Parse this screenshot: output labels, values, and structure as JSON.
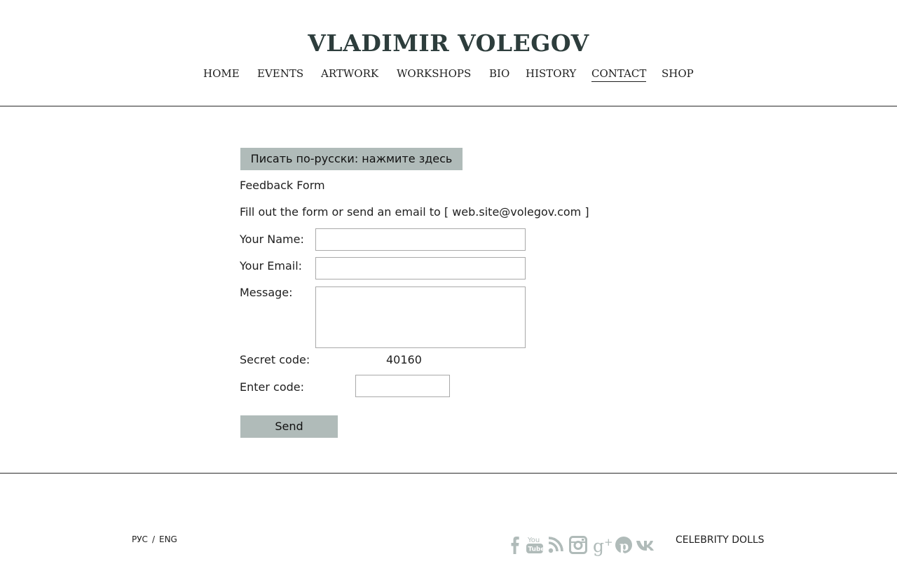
{
  "header": {
    "title": "VLADIMIR VOLEGOV",
    "nav": [
      {
        "label": "HOME"
      },
      {
        "label": "EVENTS"
      },
      {
        "label": "ARTWORK"
      },
      {
        "label": "WORKSHOPS"
      },
      {
        "label": "BIO"
      },
      {
        "label": "HISTORY"
      },
      {
        "label": "CONTACT",
        "active": true
      },
      {
        "label": "SHOP"
      }
    ]
  },
  "form": {
    "russian_button": "Писать по-русски: нажмите здесь",
    "heading": "Feedback Form",
    "intro": "Fill out the form or send an email to [ web.site@volegov.com ]",
    "name_label": "Your Name:",
    "name_value": "",
    "email_label": "Your Email:",
    "email_value": "",
    "message_label": "Message:",
    "message_value": "",
    "secret_label": "Secret code:",
    "secret_value": "40160",
    "enter_code_label": "Enter code:",
    "enter_code_value": "",
    "send_label": "Send"
  },
  "footer": {
    "lang_ru": "РУС",
    "lang_sep": "/",
    "lang_en": "ENG",
    "social_icons": [
      "facebook-icon",
      "youtube-icon",
      "rss-icon",
      "instagram-icon",
      "google-plus-icon",
      "pinterest-icon",
      "vk-icon"
    ],
    "social_color": "#b0bbb9",
    "celebrity_link": "CELEBRITY DOLLS"
  },
  "colors": {
    "accent_button": "#b0bbb9",
    "title": "#2d3d3c"
  }
}
